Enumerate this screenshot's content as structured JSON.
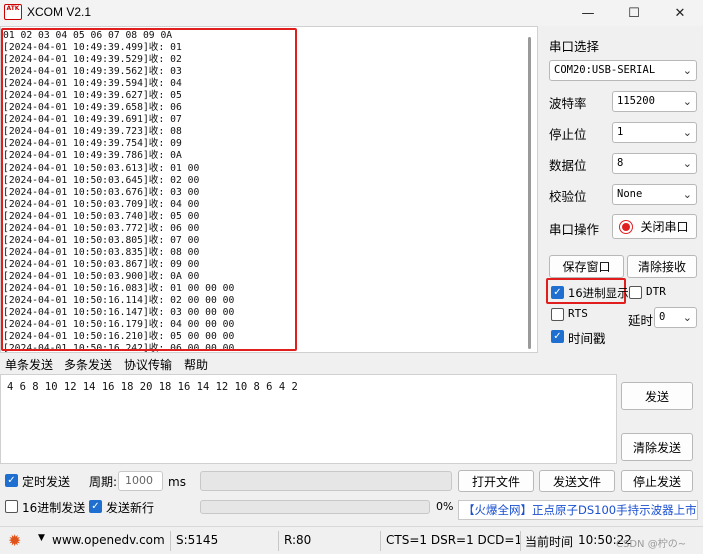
{
  "window": {
    "logo_text": "ATK",
    "title": "XCOM V2.1",
    "minimize": "—",
    "maximize": "☐",
    "close": "✕"
  },
  "receive": {
    "lines": [
      "01 02 03 04 05 06 07 08 09 0A",
      "[2024-04-01 10:49:39.499]收: 01",
      "[2024-04-01 10:49:39.529]收: 02",
      "[2024-04-01 10:49:39.562]收: 03",
      "[2024-04-01 10:49:39.594]收: 04",
      "[2024-04-01 10:49:39.627]收: 05",
      "[2024-04-01 10:49:39.658]收: 06",
      "[2024-04-01 10:49:39.691]收: 07",
      "[2024-04-01 10:49:39.723]收: 08",
      "[2024-04-01 10:49:39.754]收: 09",
      "[2024-04-01 10:49:39.786]收: 0A",
      "[2024-04-01 10:50:03.613]收: 01 00",
      "[2024-04-01 10:50:03.645]收: 02 00",
      "[2024-04-01 10:50:03.676]收: 03 00",
      "[2024-04-01 10:50:03.709]收: 04 00",
      "[2024-04-01 10:50:03.740]收: 05 00",
      "[2024-04-01 10:50:03.772]收: 06 00",
      "[2024-04-01 10:50:03.805]收: 07 00",
      "[2024-04-01 10:50:03.835]收: 08 00",
      "[2024-04-01 10:50:03.867]收: 09 00",
      "[2024-04-01 10:50:03.900]收: 0A 00",
      "[2024-04-01 10:50:16.083]收: 01 00 00 00",
      "[2024-04-01 10:50:16.114]收: 02 00 00 00",
      "[2024-04-01 10:50:16.147]收: 03 00 00 00",
      "[2024-04-01 10:50:16.179]收: 04 00 00 00",
      "[2024-04-01 10:50:16.210]收: 05 00 00 00",
      "[2024-04-01 10:50:16.242]收: 06 00 00 00"
    ]
  },
  "settings": {
    "port_label": "串口选择",
    "port_value": "COM20:USB-SERIAL",
    "baud_label": "波特率",
    "baud_value": "115200",
    "stop_label": "停止位",
    "stop_value": "1",
    "data_label": "数据位",
    "data_value": "8",
    "parity_label": "校验位",
    "parity_value": "None",
    "op_label": "串口操作",
    "close_port": "关闭串口",
    "save_window": "保存窗口",
    "clear_receive": "清除接收",
    "hex_display": "16进制显示",
    "dtr": "DTR",
    "rts": "RTS",
    "delay_label": "延时",
    "delay_value": "0",
    "timestamp": "时间戳"
  },
  "tabs": [
    "单条发送",
    "多条发送",
    "协议传输",
    "帮助"
  ],
  "send": {
    "text": "4 6 8 10 12 14 16 18 20 18 16 14 12 10 8 6 4 2",
    "send_button": "发送",
    "clear_send": "清除发送"
  },
  "bottom": {
    "timed_send": "定时发送",
    "period_label": "周期:",
    "period_value": "1000",
    "ms": "ms",
    "open_file": "打开文件",
    "send_file": "发送文件",
    "stop_send": "停止发送",
    "hex_send": "16进制发送",
    "send_newline": "发送新行",
    "progress_pct": "0%",
    "banner_1": "【火爆全网】",
    "banner_2": "正点原子DS100手持示波器上市"
  },
  "status": {
    "url": "www.openedv.com",
    "sent": "S:5145",
    "recv": "R:80",
    "signals": "CTS=1 DSR=1 DCD=1",
    "time_label": "当前时间",
    "time_value": "10:50:22",
    "watermark": "CSDN @柠の~"
  },
  "colors": {
    "highlight": "#e01e1e",
    "checkbox_on": "#1e6fd0",
    "banner_blue": "#1a4fd0",
    "banner_red": "#d01a1a"
  }
}
